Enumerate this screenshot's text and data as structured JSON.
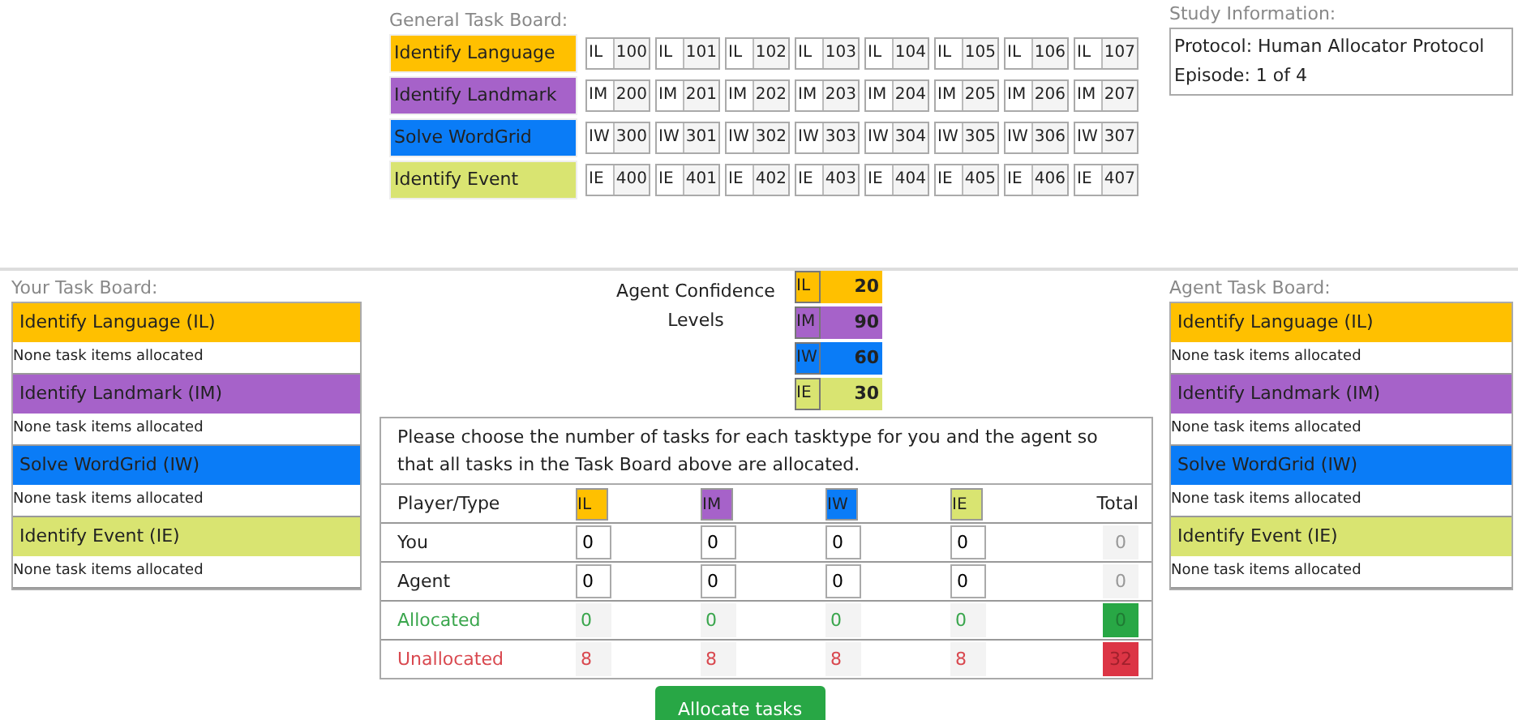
{
  "general_board": {
    "title": "General Task Board:",
    "rows": [
      {
        "label": "Identify Language",
        "color": "#ffc000",
        "items": [
          {
            "code": "IL",
            "number": "100"
          },
          {
            "code": "IL",
            "number": "101"
          },
          {
            "code": "IL",
            "number": "102"
          },
          {
            "code": "IL",
            "number": "103"
          },
          {
            "code": "IL",
            "number": "104"
          },
          {
            "code": "IL",
            "number": "105"
          },
          {
            "code": "IL",
            "number": "106"
          },
          {
            "code": "IL",
            "number": "107"
          }
        ]
      },
      {
        "label": "Identify Landmark",
        "color": "#a662c9",
        "items": [
          {
            "code": "IM",
            "number": "200"
          },
          {
            "code": "IM",
            "number": "201"
          },
          {
            "code": "IM",
            "number": "202"
          },
          {
            "code": "IM",
            "number": "203"
          },
          {
            "code": "IM",
            "number": "204"
          },
          {
            "code": "IM",
            "number": "205"
          },
          {
            "code": "IM",
            "number": "206"
          },
          {
            "code": "IM",
            "number": "207"
          }
        ]
      },
      {
        "label": "Solve WordGrid",
        "color": "#0a7cf7",
        "items": [
          {
            "code": "IW",
            "number": "300"
          },
          {
            "code": "IW",
            "number": "301"
          },
          {
            "code": "IW",
            "number": "302"
          },
          {
            "code": "IW",
            "number": "303"
          },
          {
            "code": "IW",
            "number": "304"
          },
          {
            "code": "IW",
            "number": "305"
          },
          {
            "code": "IW",
            "number": "306"
          },
          {
            "code": "IW",
            "number": "307"
          }
        ]
      },
      {
        "label": "Identify Event",
        "color": "#d9e471",
        "items": [
          {
            "code": "IE",
            "number": "400"
          },
          {
            "code": "IE",
            "number": "401"
          },
          {
            "code": "IE",
            "number": "402"
          },
          {
            "code": "IE",
            "number": "403"
          },
          {
            "code": "IE",
            "number": "404"
          },
          {
            "code": "IE",
            "number": "405"
          },
          {
            "code": "IE",
            "number": "406"
          },
          {
            "code": "IE",
            "number": "407"
          }
        ]
      }
    ]
  },
  "study_info": {
    "title": "Study Information:",
    "lines": [
      "Protocol: Human Allocator Protocol",
      "Episode: 1 of 4"
    ]
  },
  "your_board": {
    "title": "Your Task Board:",
    "groups": [
      {
        "label": "Identify Language (IL)",
        "color": "#ffc000",
        "status": "None task items allocated"
      },
      {
        "label": "Identify Landmark (IM)",
        "color": "#a662c9",
        "status": "None task items allocated"
      },
      {
        "label": "Solve WordGrid (IW)",
        "color": "#0a7cf7",
        "status": "None task items allocated"
      },
      {
        "label": "Identify Event (IE)",
        "color": "#d9e471",
        "status": "None task items allocated"
      }
    ]
  },
  "agent_confidence": {
    "title": "Agent Confidence Levels",
    "rows": [
      {
        "code": "IL",
        "color": "#ffc000",
        "value": "20"
      },
      {
        "code": "IM",
        "color": "#a662c9",
        "value": "90"
      },
      {
        "code": "IW",
        "color": "#0a7cf7",
        "value": "60"
      },
      {
        "code": "IE",
        "color": "#d9e471",
        "value": "30"
      }
    ]
  },
  "allocation": {
    "instructions": "Please choose the number of tasks for each tasktype for you and the agent so that all tasks in the Task Board above are allocated.",
    "first_header": "Player/Type",
    "type_headers": [
      {
        "code": "IL",
        "color": "#ffc000"
      },
      {
        "code": "IM",
        "color": "#a662c9"
      },
      {
        "code": "IW",
        "color": "#0a7cf7"
      },
      {
        "code": "IE",
        "color": "#d9e471"
      }
    ],
    "total_header": "Total",
    "rows": [
      {
        "label": "You",
        "kind": "input",
        "values": [
          "0",
          "0",
          "0",
          "0"
        ],
        "total": "0"
      },
      {
        "label": "Agent",
        "kind": "input",
        "values": [
          "0",
          "0",
          "0",
          "0"
        ],
        "total": "0"
      },
      {
        "label": "Allocated",
        "kind": "allocated",
        "values": [
          "0",
          "0",
          "0",
          "0"
        ],
        "total": "0"
      },
      {
        "label": "Unallocated",
        "kind": "unallocated",
        "values": [
          "8",
          "8",
          "8",
          "8"
        ],
        "total": "32"
      }
    ]
  },
  "agent_board": {
    "title": "Agent Task Board:",
    "groups": [
      {
        "label": "Identify Language (IL)",
        "color": "#ffc000",
        "status": "None task items allocated"
      },
      {
        "label": "Identify Landmark (IM)",
        "color": "#a662c9",
        "status": "None task items allocated"
      },
      {
        "label": "Solve WordGrid (IW)",
        "color": "#0a7cf7",
        "status": "None task items allocated"
      },
      {
        "label": "Identify Event (IE)",
        "color": "#d9e471",
        "status": "None task items allocated"
      }
    ]
  },
  "button": "Allocate tasks"
}
